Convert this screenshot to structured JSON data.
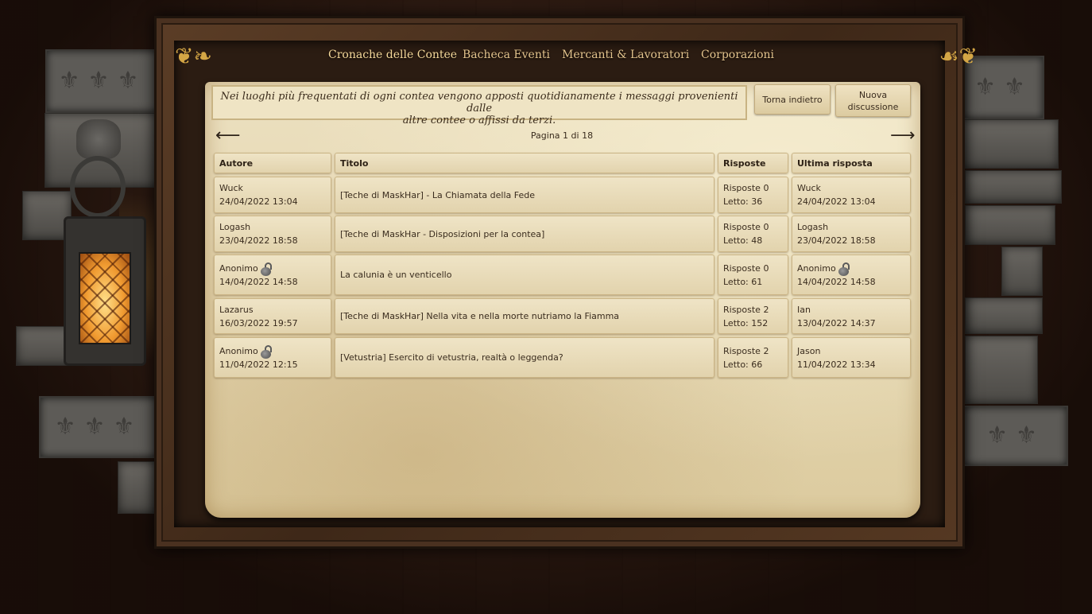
{
  "nav": {
    "items": [
      {
        "label": "Cronache delle Contee",
        "active": true
      },
      {
        "label": "Bacheca Eventi",
        "active": false
      },
      {
        "label": "Mercanti & Lavoratori",
        "active": false
      },
      {
        "label": "Corporazioni",
        "active": false
      }
    ]
  },
  "notice": {
    "line1": "Nei luoghi più frequentati di ogni contea vengono apposti quotidianamente i messaggi provenienti dalle",
    "line2": "altre contee o affissi da terzi."
  },
  "buttons": {
    "back": "Torna indietro",
    "new_line1": "Nuova",
    "new_line2": "discussione"
  },
  "pager": {
    "text": "Pagina 1 di 18",
    "prev_icon": "arrow-left-icon",
    "next_icon": "arrow-right-icon"
  },
  "table": {
    "headers": [
      "Autore",
      "Titolo",
      "Risposte",
      "Ultima risposta"
    ],
    "rows": [
      {
        "author": "Wuck",
        "author_date": "24/04/2022 13:04",
        "author_locked": false,
        "title": "[Teche di MaskHar] - La Chiamata della Fede",
        "replies": "Risposte 0",
        "reads": "Letto: 36",
        "last_author": "Wuck",
        "last_date": "24/04/2022 13:04",
        "last_locked": false
      },
      {
        "author": "Logash",
        "author_date": "23/04/2022 18:58",
        "author_locked": false,
        "title": "[Teche di MaskHar - Disposizioni per la contea]",
        "replies": "Risposte 0",
        "reads": "Letto: 48",
        "last_author": "Logash",
        "last_date": "23/04/2022 18:58",
        "last_locked": false
      },
      {
        "author": "Anonimo",
        "author_date": "14/04/2022 14:58",
        "author_locked": true,
        "title": "La calunia è un venticello",
        "replies": "Risposte 0",
        "reads": "Letto: 61",
        "last_author": "Anonimo",
        "last_date": "14/04/2022 14:58",
        "last_locked": true
      },
      {
        "author": "Lazarus",
        "author_date": "16/03/2022 19:57",
        "author_locked": false,
        "title": "[Teche di MaskHar] Nella vita e nella morte nutriamo la Fiamma",
        "replies": "Risposte 2",
        "reads": "Letto: 152",
        "last_author": "Ian",
        "last_date": "13/04/2022 14:37",
        "last_locked": false
      },
      {
        "author": "Anonimo",
        "author_date": "11/04/2022 12:15",
        "author_locked": true,
        "title": "[Vetustria] Esercito di vetustria, realtà o leggenda?",
        "replies": "Risposte 2",
        "reads": "Letto: 66",
        "last_author": "Jason",
        "last_date": "11/04/2022 13:34",
        "last_locked": false
      }
    ]
  },
  "colors": {
    "nav_text": "#e4c48d",
    "parchment": "#e6d8b4",
    "frame_wood": "#4a3120",
    "text": "#3a2c1e"
  }
}
